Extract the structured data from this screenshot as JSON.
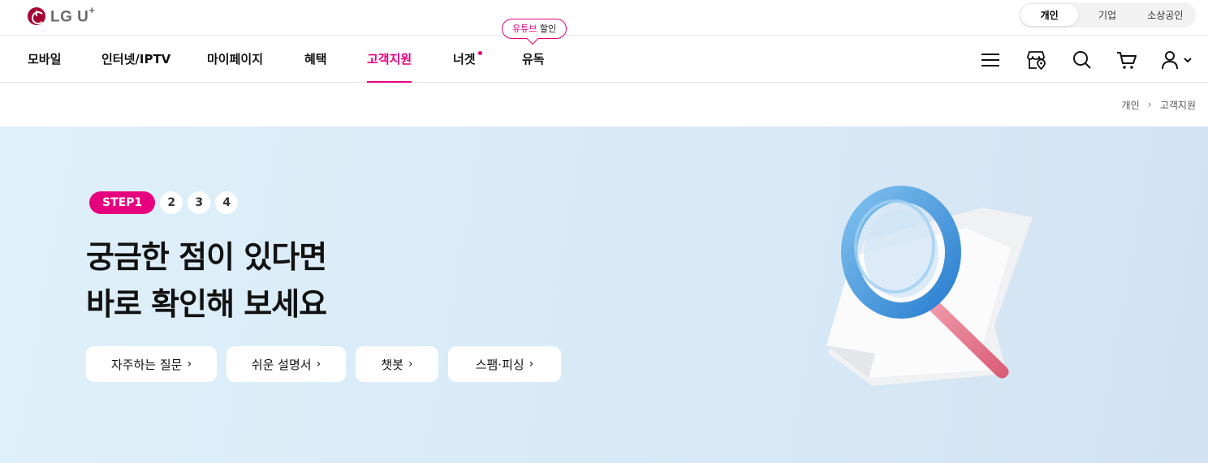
{
  "brand": {
    "logo_text": "LG U",
    "logo_plus": "+"
  },
  "segments": [
    {
      "label": "개인",
      "active": true
    },
    {
      "label": "기업",
      "active": false
    },
    {
      "label": "소상공인",
      "active": false
    }
  ],
  "nav": {
    "items": [
      {
        "label": "모바일"
      },
      {
        "label": "인터넷/IPTV"
      },
      {
        "label": "마이페이지"
      },
      {
        "label": "혜택"
      },
      {
        "label": "고객지원",
        "active": true
      },
      {
        "label": "너겟",
        "new_dot": true
      },
      {
        "label": "유독"
      }
    ],
    "promo_bubble": {
      "pink": "유튜브",
      "text": "할인"
    },
    "icons": [
      "menu-icon",
      "store-location-icon",
      "search-icon",
      "cart-icon",
      "user-icon"
    ]
  },
  "breadcrumb": {
    "home": "개인",
    "current": "고객지원"
  },
  "hero": {
    "steps": {
      "active": "STEP1",
      "others": [
        "2",
        "3",
        "4"
      ]
    },
    "title_line1": "궁금한 점이 있다면",
    "title_line2": "바로 확인해 보세요",
    "buttons": [
      {
        "label": "자주하는 질문"
      },
      {
        "label": "쉬운 설명서"
      },
      {
        "label": "챗봇"
      },
      {
        "label": "스팸·피싱"
      }
    ]
  },
  "colors": {
    "accent": "#e6007e",
    "brand": "#a50034",
    "hero_bg": "#dcecf8"
  }
}
